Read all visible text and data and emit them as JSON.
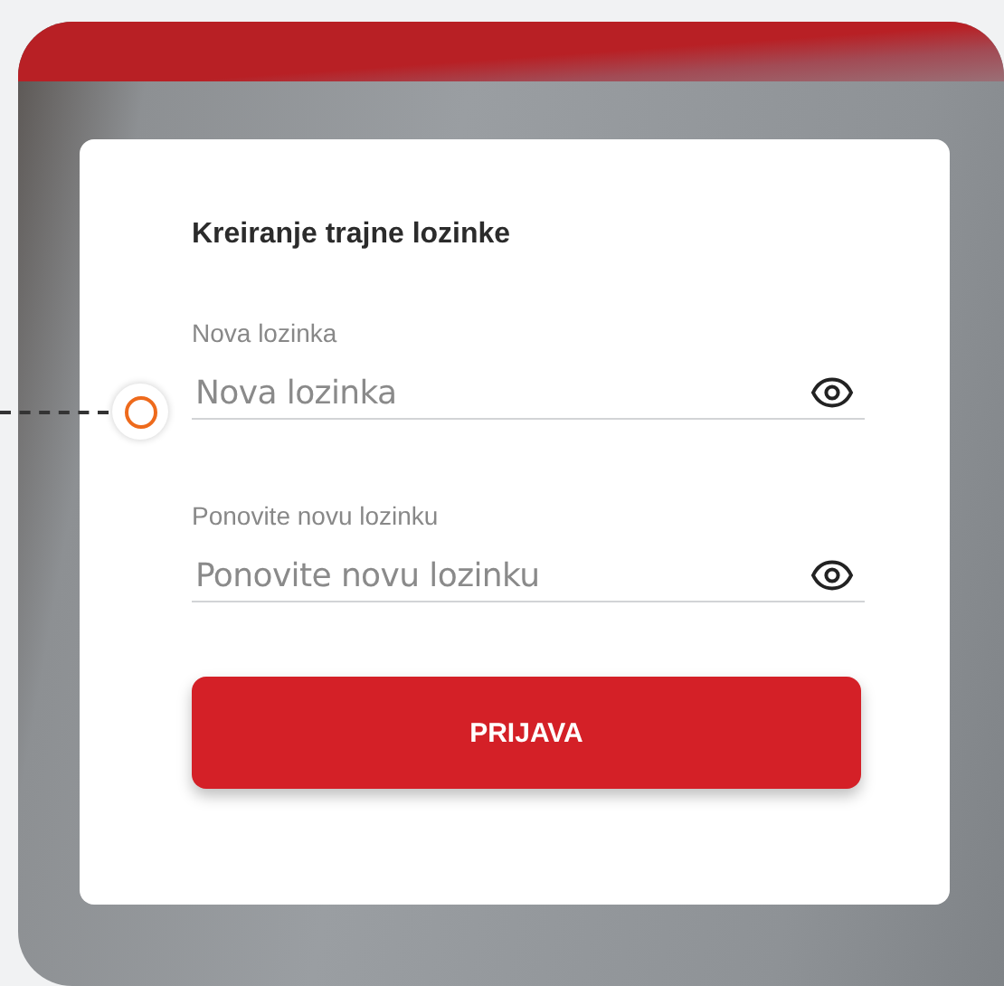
{
  "form": {
    "title": "Kreiranje trajne lozinke",
    "fields": [
      {
        "label": "Nova lozinka",
        "placeholder": "Nova lozinka"
      },
      {
        "label": "Ponovite novu lozinku",
        "placeholder": "Ponovite novu lozinku"
      }
    ],
    "submit_button": "PRIJAVA"
  }
}
